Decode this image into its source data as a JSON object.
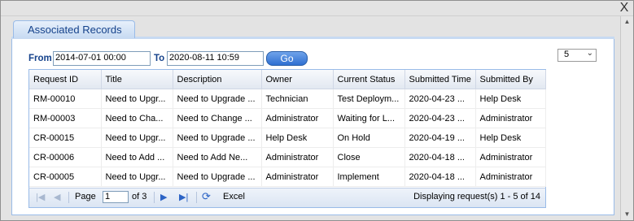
{
  "window": {
    "close_label": "X"
  },
  "tab": {
    "label": "Associated Records"
  },
  "filters": {
    "from_label": "From",
    "from_value": "2014-07-01 00:00",
    "to_label": "To",
    "to_value": "2020-08-11 10:59",
    "go_label": "Go",
    "page_size": "5"
  },
  "grid": {
    "columns": [
      "Request ID",
      "Title",
      "Description",
      "Owner",
      "Current Status",
      "Submitted Time",
      "Submitted By"
    ],
    "rows": [
      [
        "RM-00010",
        "Need to Upgr...",
        "Need to Upgrade ...",
        "Technician",
        "Test Deploym...",
        "2020-04-23 ...",
        "Help Desk"
      ],
      [
        "RM-00003",
        "Need to Cha...",
        "Need to Change ...",
        "Administrator",
        "Waiting for L...",
        "2020-04-23 ...",
        "Administrator"
      ],
      [
        "CR-00015",
        "Need to Upgr...",
        "Need to Upgrade ...",
        "Help Desk",
        "On Hold",
        "2020-04-19 ...",
        "Help Desk"
      ],
      [
        "CR-00006",
        "Need to Add ...",
        "Need to Add Ne...",
        "Administrator",
        "Close",
        "2020-04-18 ...",
        "Administrator"
      ],
      [
        "CR-00005",
        "Need to Upgr...",
        "Need to Upgrade ...",
        "Administrator",
        "Implement",
        "2020-04-18 ...",
        "Administrator"
      ]
    ]
  },
  "pager": {
    "page_label": "Page",
    "page_value": "1",
    "of_label": "of 3",
    "excel_label": "Excel",
    "display_text": "Displaying request(s) 1 - 5 of 14"
  }
}
